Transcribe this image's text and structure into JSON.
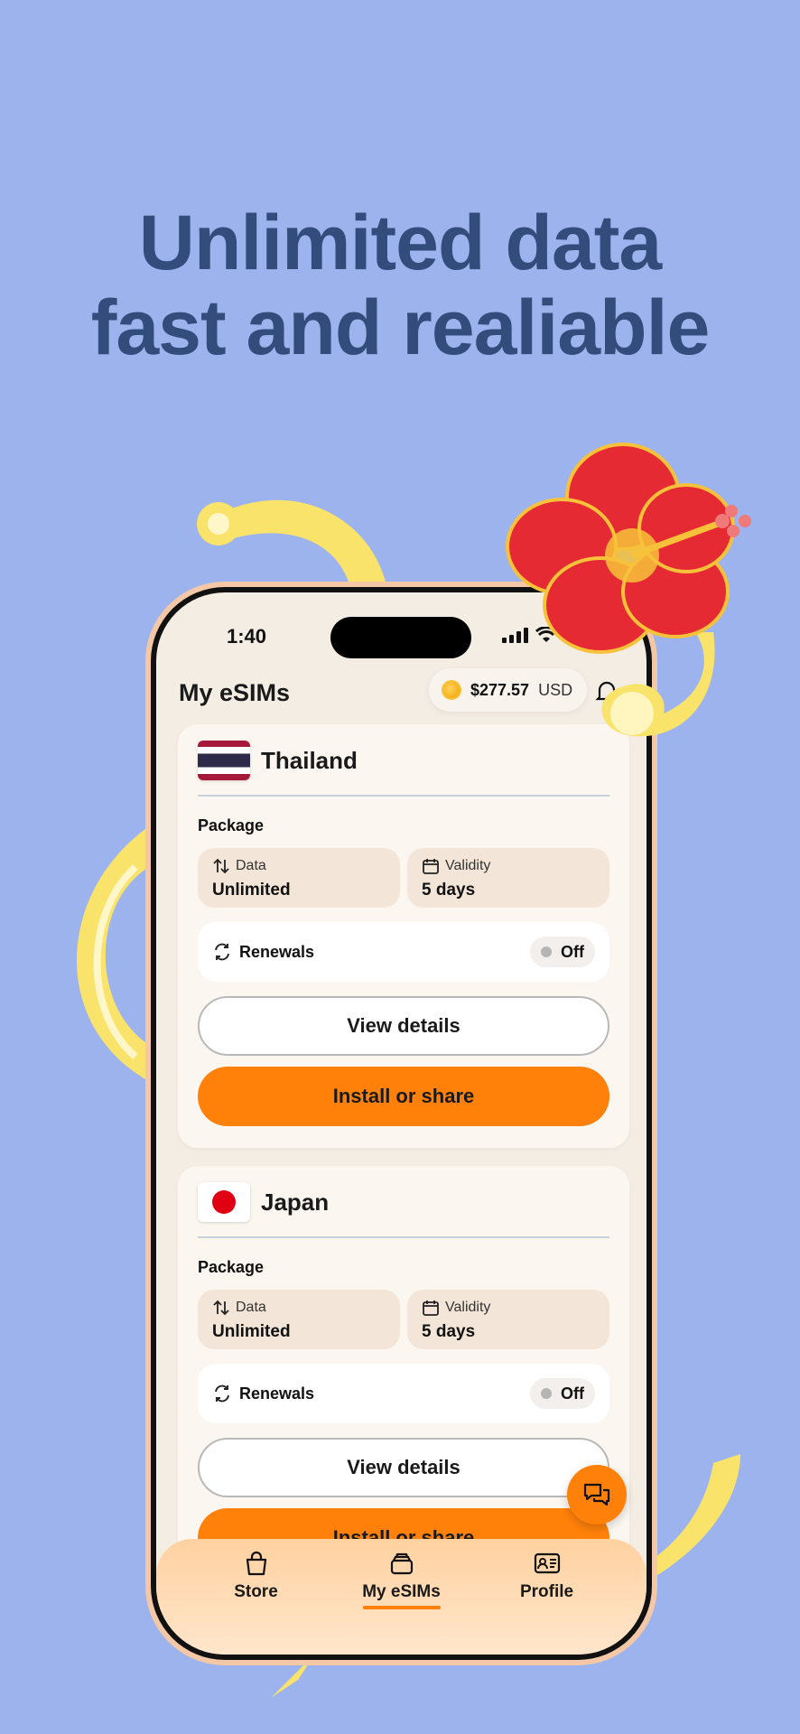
{
  "headline": {
    "line1": "Unlimited data",
    "line2": "fast and realiable"
  },
  "status": {
    "time": "1:40"
  },
  "header": {
    "title": "My eSIMs",
    "balance_amount": "$277.57",
    "balance_currency": "USD"
  },
  "esims": [
    {
      "country": "Thailand",
      "package_label": "Package",
      "data_label": "Data",
      "data_value": "Unlimited",
      "validity_label": "Validity",
      "validity_value": "5 days",
      "renewals_label": "Renewals",
      "renewals_state": "Off",
      "view_details": "View details",
      "install": "Install or share"
    },
    {
      "country": "Japan",
      "package_label": "Package",
      "data_label": "Data",
      "data_value": "Unlimited",
      "validity_label": "Validity",
      "validity_value": "5 days",
      "renewals_label": "Renewals",
      "renewals_state": "Off",
      "view_details": "View details",
      "install": "Install or share"
    }
  ],
  "tabbar": {
    "store": "Store",
    "my_esims": "My eSIMs",
    "profile": "Profile",
    "active": "My eSIMs"
  },
  "colors": {
    "accent": "#ff810a",
    "background": "#9db3ee",
    "headline": "#324d7c"
  },
  "icons": [
    "signal-icon",
    "wifi-icon",
    "battery-icon",
    "coin-icon",
    "bell-icon",
    "data-transfer-icon",
    "calendar-icon",
    "refresh-icon",
    "chat-icon",
    "bag-icon",
    "sim-stack-icon",
    "id-card-icon",
    "hibiscus-flower"
  ]
}
